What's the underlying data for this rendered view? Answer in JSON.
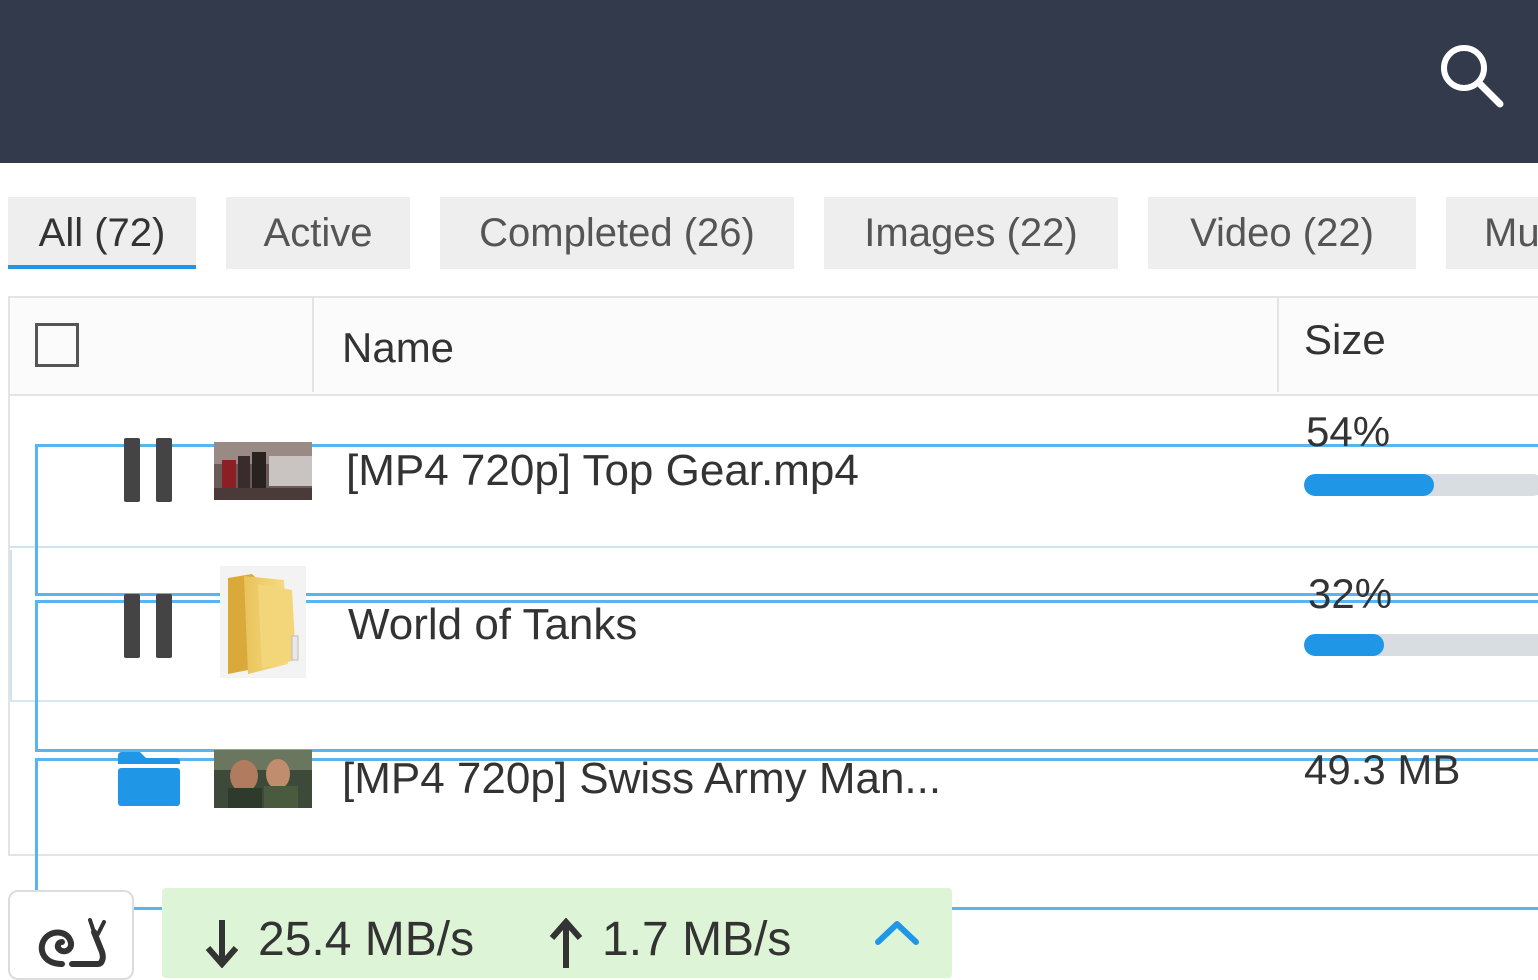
{
  "header": {
    "search_icon": "search-icon",
    "background": "#323a4b"
  },
  "tabs": [
    {
      "label": "All (72)",
      "active": true
    },
    {
      "label": "Active",
      "active": false
    },
    {
      "label": "Completed (26)",
      "active": false
    },
    {
      "label": "Images (22)",
      "active": false
    },
    {
      "label": "Video (22)",
      "active": false
    },
    {
      "label": "Mu",
      "active": false
    }
  ],
  "table": {
    "columns": {
      "name": "Name",
      "size": "Size"
    },
    "rows": [
      {
        "name": "[MP4 720p] Top Gear.mp4",
        "status": "paused",
        "status_icon": "pause-icon",
        "thumb": "video-thumbnail",
        "progress_label": "54%",
        "progress": 0.54
      },
      {
        "name": "World of Tanks",
        "status": "paused",
        "status_icon": "pause-icon",
        "thumb": "folder-icon",
        "progress_label": "32%",
        "progress": 0.32
      },
      {
        "name": "[MP4 720p] Swiss Army Man...",
        "status": "completed",
        "status_icon": "open-folder-icon",
        "thumb": "video-thumbnail",
        "size": "49.3 MB"
      }
    ]
  },
  "footer": {
    "turtle_icon": "snail-icon",
    "download_speed": "25.4 MB/s",
    "upload_speed": "1.7 MB/s",
    "accent": "#1f96e6",
    "speed_bg": "#ddf5d6"
  }
}
